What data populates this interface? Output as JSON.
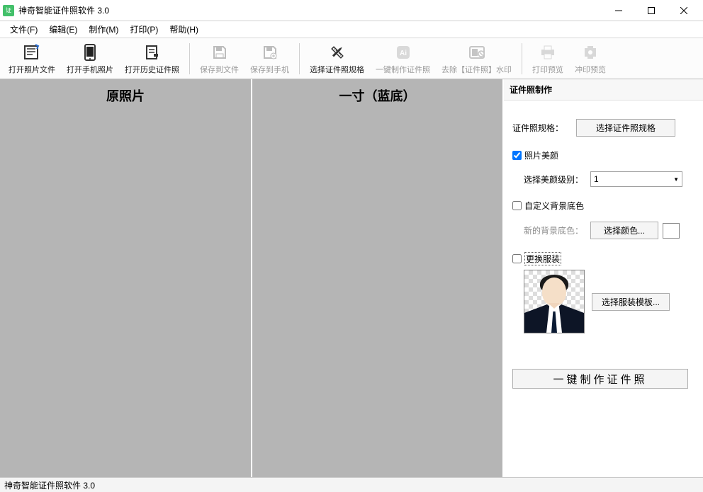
{
  "window": {
    "title": "神奇智能证件照软件 3.0"
  },
  "menu": {
    "file": "文件(F)",
    "edit": "编辑(E)",
    "make": "制作(M)",
    "print": "打印(P)",
    "help": "帮助(H)"
  },
  "toolbar": {
    "open_photo_file": "打开照片文件",
    "open_phone_photo": "打开手机照片",
    "open_history": "打开历史证件照",
    "save_to_file": "保存到文件",
    "save_to_phone": "保存到手机",
    "choose_spec": "选择证件照规格",
    "one_click_make": "一键制作证件照",
    "remove_watermark": "去除【证件照】水印",
    "print_preview": "打印预览",
    "dev_preview": "冲印预览"
  },
  "panes": {
    "original": "原照片",
    "result": "一寸（蓝底）"
  },
  "panel": {
    "header": "证件照制作",
    "spec_label": "证件照规格：",
    "spec_button": "选择证件照规格",
    "beauty_check": "照片美颜",
    "beauty_level_label": "选择美颜级别：",
    "beauty_level_value": "1",
    "custom_bg_check": "自定义背景底色",
    "new_bg_label": "新的背景底色：",
    "choose_color": "选择颜色...",
    "change_clothes_check": "更换服装",
    "choose_clothes_template": "选择服装模板...",
    "one_click_button": "一键制作证件照"
  },
  "status": {
    "text": "神奇智能证件照软件 3.0"
  }
}
